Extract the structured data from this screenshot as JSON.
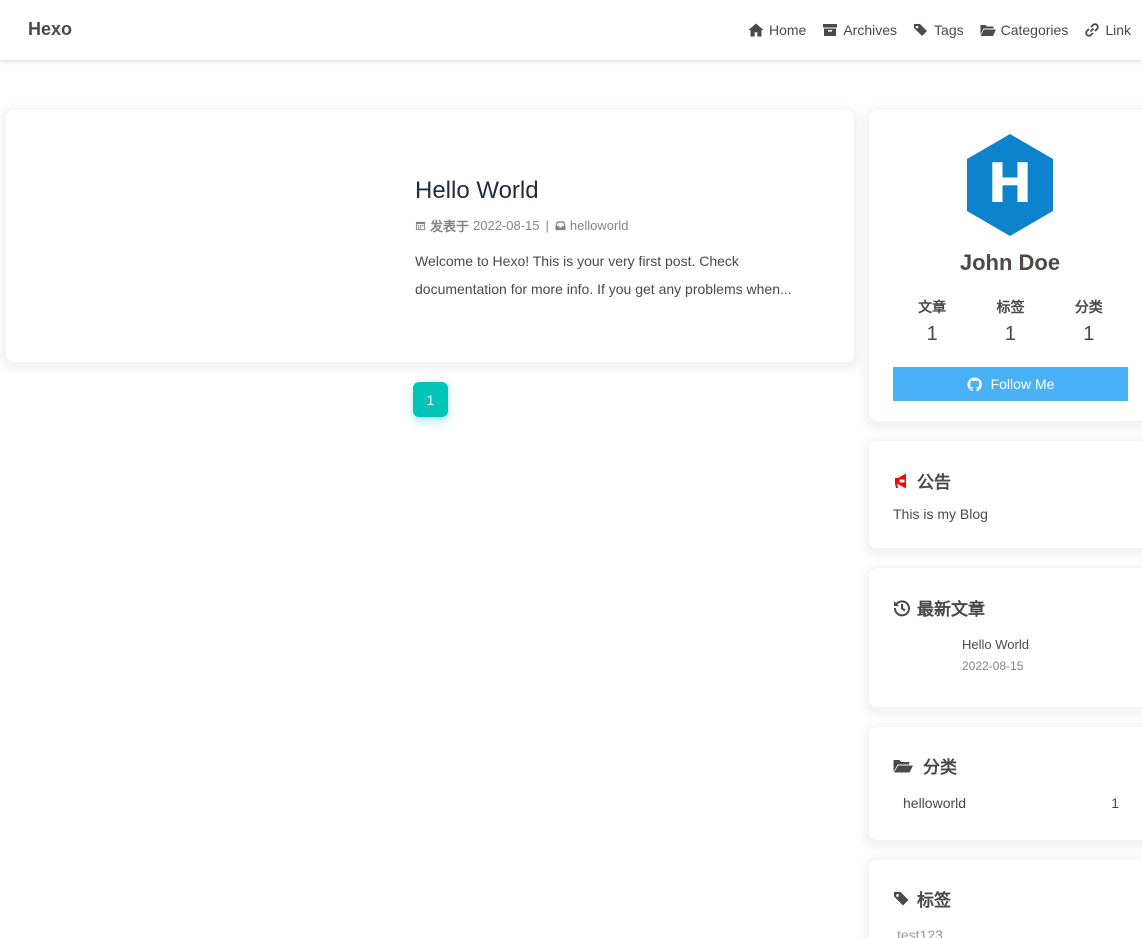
{
  "header": {
    "site_name": "Hexo",
    "menu": [
      {
        "label": "Home",
        "icon": "home-icon"
      },
      {
        "label": "Archives",
        "icon": "archive-icon"
      },
      {
        "label": "Tags",
        "icon": "tags-icon"
      },
      {
        "label": "Categories",
        "icon": "folder-open-icon"
      },
      {
        "label": "Link",
        "icon": "link-icon"
      }
    ]
  },
  "post": {
    "title": "Hello World",
    "meta_label": "发表于",
    "date": "2022-08-15",
    "separator": "|",
    "category": "helloworld",
    "excerpt": "Welcome to Hexo! This is your very first post. Check documentation for more info. If you get any problems when..."
  },
  "pagination": {
    "current": "1",
    "active_color": "#00c4b6"
  },
  "author": {
    "avatar_letter": "H",
    "avatar_color": "#0e83cd",
    "name": "John Doe",
    "stats": [
      {
        "label": "文章",
        "value": "1"
      },
      {
        "label": "标签",
        "value": "1"
      },
      {
        "label": "分类",
        "value": "1"
      }
    ],
    "follow_label": "Follow Me",
    "follow_color": "#49b1f5"
  },
  "announcement": {
    "title": "公告",
    "text": "This is my Blog",
    "icon_color": "#ff0000"
  },
  "recent": {
    "title": "最新文章",
    "items": [
      {
        "title": "Hello World",
        "date": "2022-08-15"
      }
    ]
  },
  "categories": {
    "title": "分类",
    "items": [
      {
        "name": "helloworld",
        "count": "1"
      }
    ]
  },
  "tags": {
    "title": "标签",
    "items": [
      "test123"
    ]
  }
}
